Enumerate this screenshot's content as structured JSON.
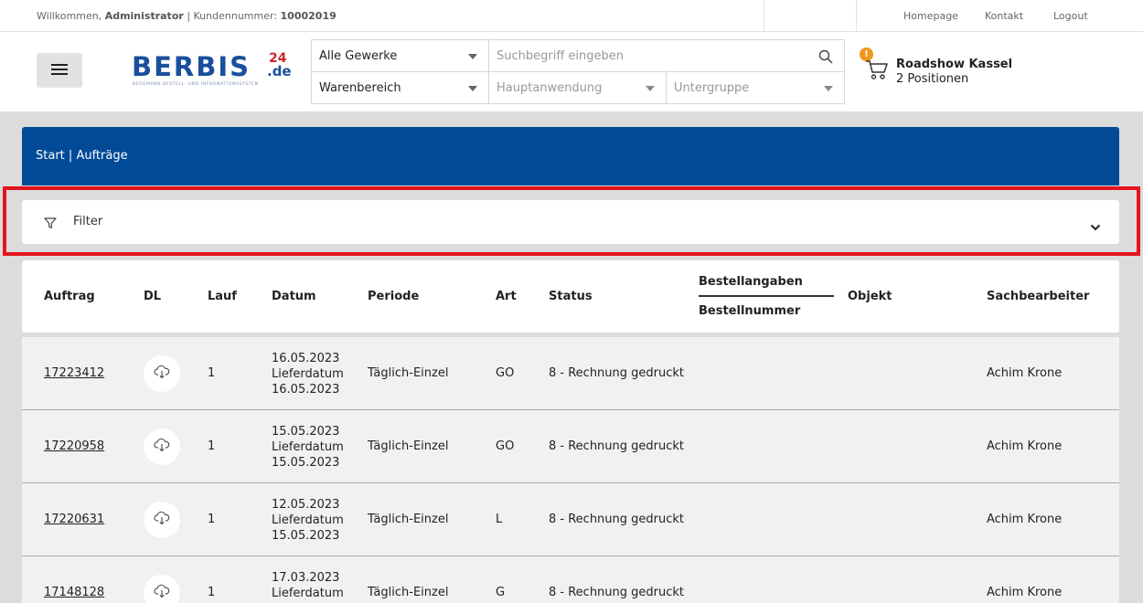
{
  "topbar": {
    "welcome_prefix": "Willkommen,",
    "user": "Administrator",
    "customer_label": "| Kundennummer:",
    "customer_number": "10002019",
    "links": [
      "Homepage",
      "Kontakt",
      "Logout"
    ]
  },
  "logo": {
    "word": "BERBIS",
    "number": "24",
    "tld": ".de",
    "tagline": "BERGMANN BESTELL- UND INFORMATIONSSYSTEM"
  },
  "search": {
    "gewerke": "Alle Gewerke",
    "placeholder": "Suchbegriff eingeben",
    "warenbereich": "Warenbereich",
    "hauptanwendung": "Hauptanwendung",
    "untergruppe": "Untergruppe"
  },
  "cart": {
    "badge": "!",
    "name": "Roadshow Kassel",
    "positions": "2 Positionen"
  },
  "breadcrumb": {
    "start": "Start",
    "separator": "|",
    "current": "Aufträge"
  },
  "filter": {
    "label": "Filter"
  },
  "table": {
    "headers": {
      "auftrag": "Auftrag",
      "dl": "DL",
      "lauf": "Lauf",
      "datum": "Datum",
      "periode": "Periode",
      "art": "Art",
      "status": "Status",
      "bestellangaben": "Bestellangaben",
      "bestellnummer": "Bestellnummer",
      "objekt": "Objekt",
      "sachbearbeiter": "Sachbearbeiter"
    },
    "rows": [
      {
        "auftrag": "17223412",
        "lauf": "1",
        "datum": "16.05.2023",
        "liefer_label": "Lieferdatum",
        "lieferdatum": "16.05.2023",
        "periode": "Täglich-Einzel",
        "art": "GO",
        "status": "8 - Rechnung gedruckt",
        "sachbearbeiter": "Achim Krone"
      },
      {
        "auftrag": "17220958",
        "lauf": "1",
        "datum": "15.05.2023",
        "liefer_label": "Lieferdatum",
        "lieferdatum": "15.05.2023",
        "periode": "Täglich-Einzel",
        "art": "GO",
        "status": "8 - Rechnung gedruckt",
        "sachbearbeiter": "Achim Krone"
      },
      {
        "auftrag": "17220631",
        "lauf": "1",
        "datum": "12.05.2023",
        "liefer_label": "Lieferdatum",
        "lieferdatum": "15.05.2023",
        "periode": "Täglich-Einzel",
        "art": "L",
        "status": "8 - Rechnung gedruckt",
        "sachbearbeiter": "Achim Krone"
      },
      {
        "auftrag": "17148128",
        "lauf": "1",
        "datum": "17.03.2023",
        "liefer_label": "Lieferdatum",
        "lieferdatum": "",
        "periode": "Täglich-Einzel",
        "art": "G",
        "status": "8 - Rechnung gedruckt",
        "sachbearbeiter": "Achim Krone"
      }
    ]
  },
  "colors": {
    "brand_blue": "#004a97",
    "logo_red": "#d4242b",
    "badge_orange": "#f0961c",
    "highlight_red": "#e3141d"
  }
}
